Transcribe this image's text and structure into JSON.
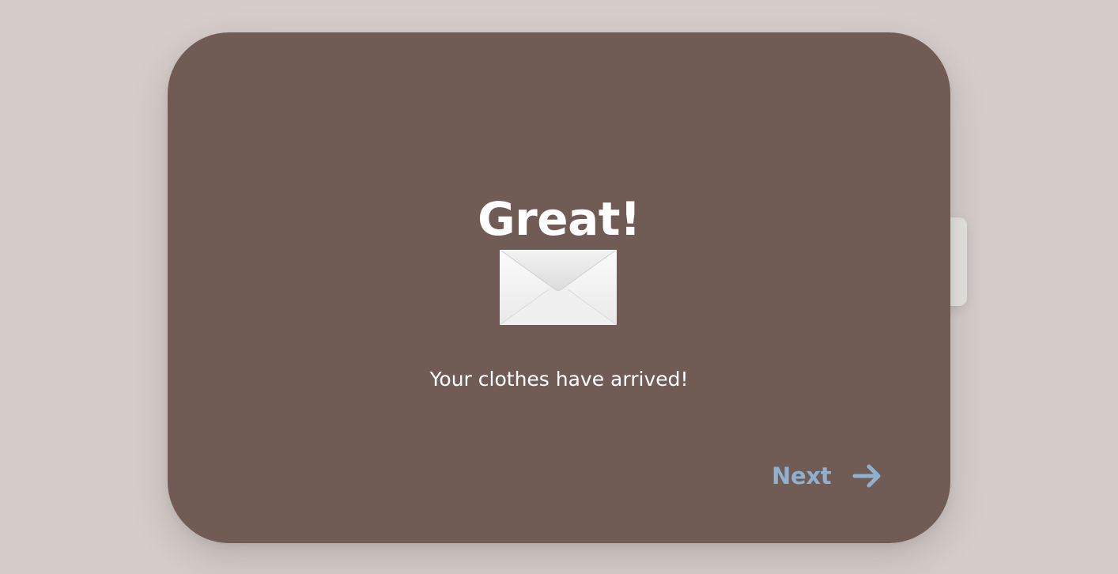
{
  "dialog": {
    "title": "Great!",
    "icon": "envelope-icon",
    "message": "Your clothes have arrived!",
    "next_label": "Next",
    "next_icon": "arrow-right-icon"
  },
  "colors": {
    "background": "#d6cdca",
    "card": "#705b55",
    "title_text": "#ffffff",
    "accent": "#8fb1cf",
    "side_tab": "#e6e2e0"
  }
}
